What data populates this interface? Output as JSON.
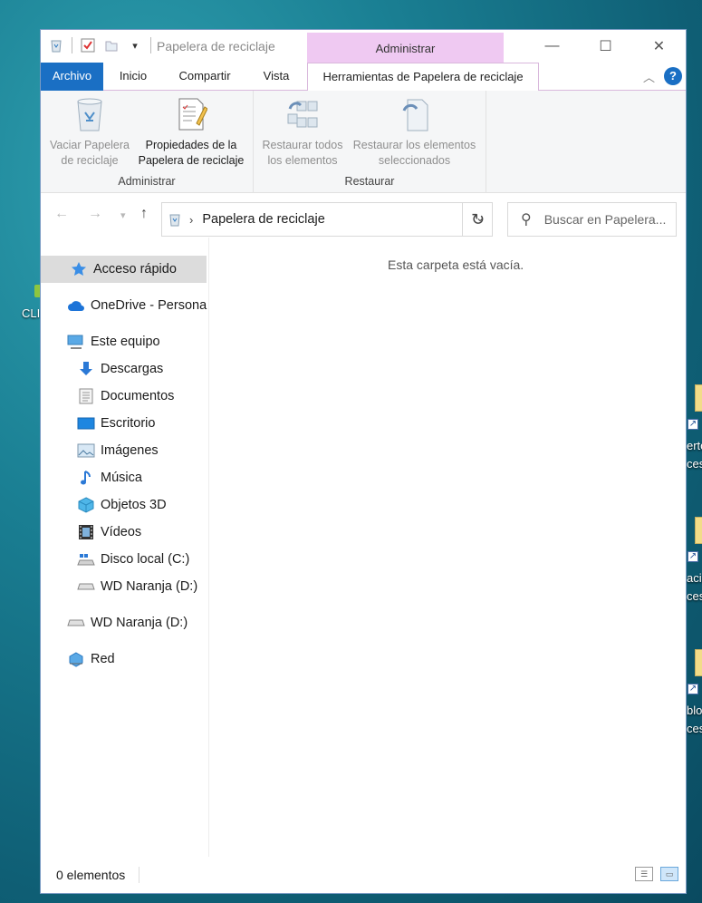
{
  "window": {
    "title": "Papelera de reciclaje",
    "context_group": "Administrar",
    "controls": {
      "minimize": "—",
      "maximize": "☐",
      "close": "✕"
    }
  },
  "tabs": {
    "file": "Archivo",
    "home": "Inicio",
    "share": "Compartir",
    "view": "Vista",
    "tools": "Herramientas de Papelera de reciclaje",
    "help": "?"
  },
  "ribbon": {
    "groups": [
      {
        "label": "Administrar",
        "buttons": [
          {
            "line1": "Vaciar Papelera",
            "line2": "de reciclaje",
            "enabled": false
          },
          {
            "line1": "Propiedades de la",
            "line2": "Papelera de reciclaje",
            "enabled": true
          }
        ]
      },
      {
        "label": "Restaurar",
        "buttons": [
          {
            "line1": "Restaurar todos",
            "line2": "los elementos",
            "enabled": false
          },
          {
            "line1": "Restaurar los elementos",
            "line2": "seleccionados",
            "enabled": false
          }
        ]
      }
    ]
  },
  "address": {
    "path": "Papelera de reciclaje",
    "search_placeholder": "Buscar en Papelera..."
  },
  "nav": {
    "items": [
      {
        "label": "Acceso rápido",
        "icon": "star-icon"
      },
      {
        "label": "OneDrive - Persona",
        "icon": "cloud-icon"
      },
      {
        "label": "Este equipo",
        "icon": "computer-icon"
      },
      {
        "label": "Descargas",
        "icon": "download-icon"
      },
      {
        "label": "Documentos",
        "icon": "document-icon"
      },
      {
        "label": "Escritorio",
        "icon": "desktop-icon"
      },
      {
        "label": "Imágenes",
        "icon": "image-icon"
      },
      {
        "label": "Música",
        "icon": "music-icon"
      },
      {
        "label": "Objetos 3D",
        "icon": "cube-icon"
      },
      {
        "label": "Vídeos",
        "icon": "video-icon"
      },
      {
        "label": "Disco local (C:)",
        "icon": "drive-icon"
      },
      {
        "label": "WD Naranja (D:)",
        "icon": "drive-icon"
      },
      {
        "label": "WD Naranja (D:)",
        "icon": "drive-icon"
      },
      {
        "label": "Red",
        "icon": "network-icon"
      }
    ]
  },
  "main": {
    "empty_message": "Esta carpeta está vacía."
  },
  "status": {
    "count": "0 elementos"
  },
  "desktop": {
    "left_label": "CLI",
    "right_labels": [
      "erto",
      "ces",
      "acis",
      "ces",
      "blo",
      "ces"
    ]
  }
}
